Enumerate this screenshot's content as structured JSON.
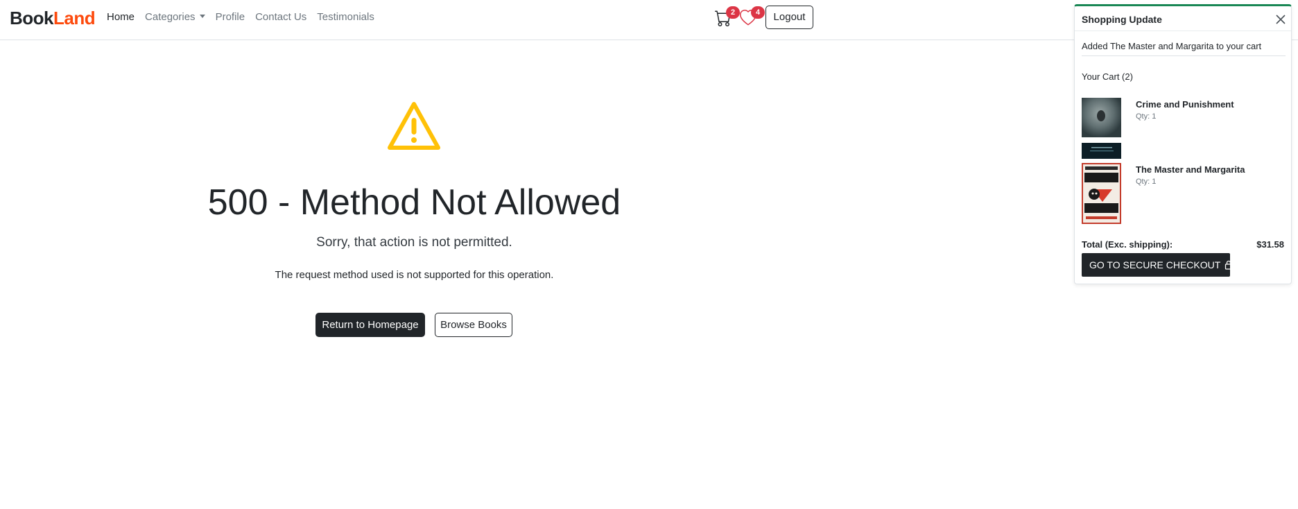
{
  "brand": {
    "part1": "Book",
    "part2": "Land"
  },
  "nav": {
    "home": "Home",
    "categories": "Categories",
    "profile": "Profile",
    "contact": "Contact Us",
    "testimonials": "Testimonials"
  },
  "header": {
    "cart_icon": "cart-icon",
    "cart_count": "2",
    "wishlist_icon": "heart-icon",
    "wishlist_count": "4",
    "logout_label": "Logout"
  },
  "error": {
    "icon": "warning-triangle-icon",
    "title": "500 - Method Not Allowed",
    "lead": "Sorry, that action is not permitted.",
    "description": "The request method used is not supported for this operation.",
    "primary_button": "Return to Homepage",
    "secondary_button": "Browse Books"
  },
  "toast": {
    "title": "Shopping Update",
    "message": "Added The Master and Margarita to your cart",
    "cart_count_label": "Your Cart (2)",
    "items": [
      {
        "name": "Crime and Punishment",
        "qty": "Qty: 1"
      },
      {
        "name": "The Master and Margarita",
        "qty": "Qty: 1"
      }
    ],
    "total_label": "Total (Exc. shipping):",
    "total_value": "$31.58",
    "checkout_label": "GO TO SECURE CHECKOUT"
  },
  "colors": {
    "brand_accent": "#fd4a0d",
    "badge": "#dc3545",
    "warning": "#ffc107",
    "dark": "#212529",
    "toast_accent": "#198754"
  }
}
